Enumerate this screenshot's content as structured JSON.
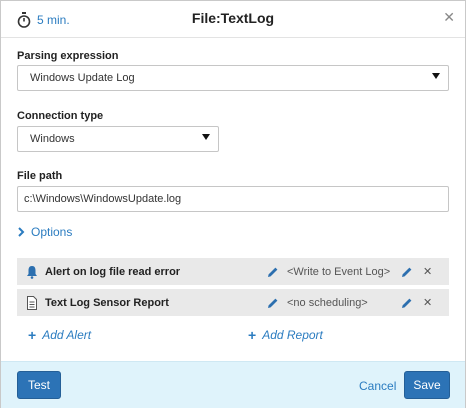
{
  "header": {
    "timer_label": "5 min.",
    "title": "File:TextLog"
  },
  "parsing": {
    "label": "Parsing expression",
    "value": "Windows Update Log"
  },
  "connection": {
    "label": "Connection type",
    "value": "Windows"
  },
  "file_path": {
    "label": "File path",
    "value": "c:\\Windows\\WindowsUpdate.log"
  },
  "options_label": "Options",
  "rows": [
    {
      "name": "Alert on log file read error",
      "value": "<Write to Event Log>",
      "icon": "bell-icon"
    },
    {
      "name": "Text Log Sensor Report",
      "value": "<no scheduling>",
      "icon": "document-icon"
    }
  ],
  "add_alert_label": "Add Alert",
  "add_report_label": "Add Report",
  "footer": {
    "test_label": "Test",
    "cancel_label": "Cancel",
    "save_label": "Save"
  },
  "colors": {
    "accent": "#2b7cc0",
    "button": "#2c73b6",
    "footer_bg": "#dff3fb",
    "row_bg": "#e9e9e9"
  }
}
